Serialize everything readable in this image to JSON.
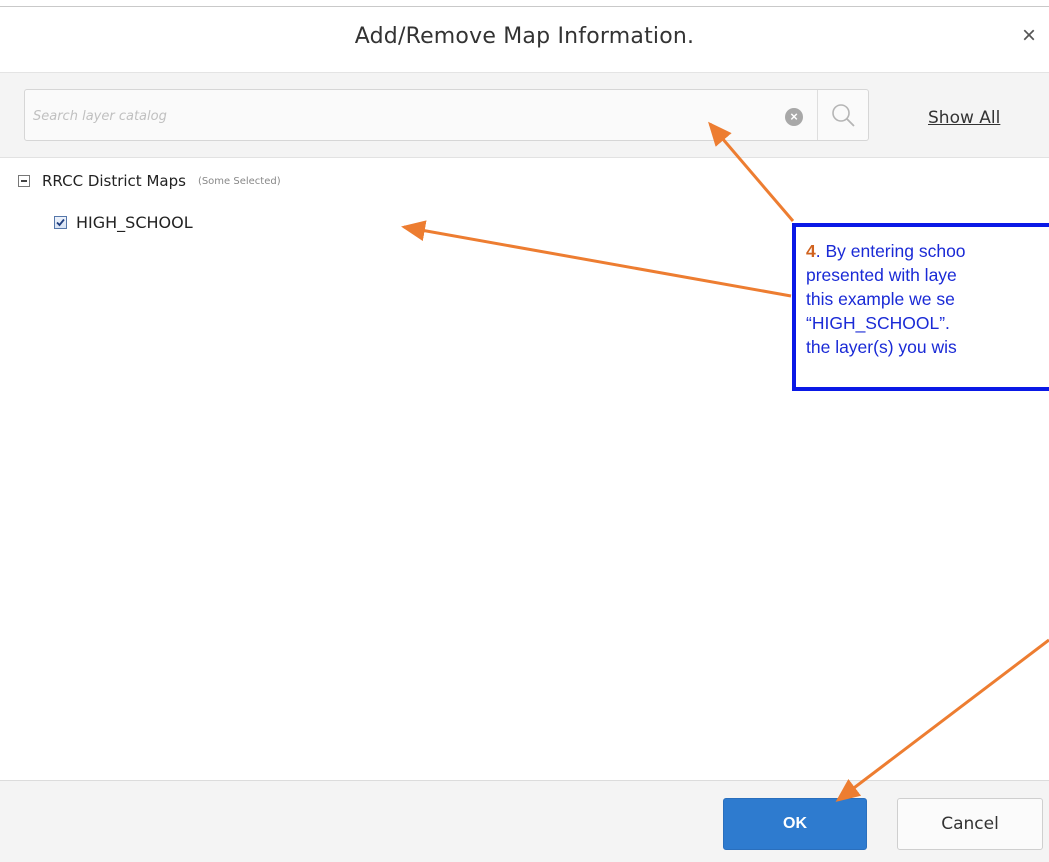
{
  "dialog": {
    "title": "Add/Remove Map Information.",
    "close_glyph": "×"
  },
  "search": {
    "placeholder": "Search layer catalog",
    "value": "",
    "clear_icon": "×",
    "show_all_label": "Show All"
  },
  "tree": {
    "group": {
      "label": "RRCC District Maps",
      "status": "(Some Selected)",
      "expanded": true
    },
    "layers": [
      {
        "label": "HIGH_SCHOOL",
        "checked": true
      }
    ]
  },
  "footer": {
    "ok_label": "OK",
    "cancel_label": "Cancel"
  },
  "annotation": {
    "number": "4",
    "text": ". By entering schoo\npresented with laye\nthis example we se\n“HIGH_SCHOOL”.\nthe layer(s) you wis"
  },
  "colors": {
    "accent": "#2e7bcf",
    "annotation_border": "#0a19e6",
    "annotation_text": "#1a2ad6",
    "arrow": "#ed7d31"
  }
}
